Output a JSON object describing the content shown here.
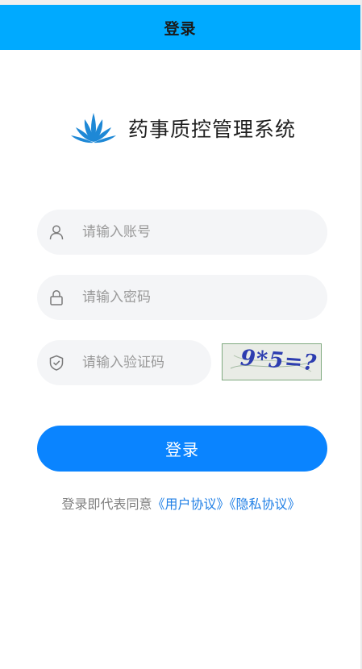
{
  "header": {
    "title": "登录"
  },
  "brand": {
    "app_name": "药事质控管理系统",
    "logo_icon": "lotus-logo-icon",
    "logo_color": "#1e88d6"
  },
  "form": {
    "username": {
      "placeholder": "请输入账号",
      "value": "",
      "icon": "user-icon"
    },
    "password": {
      "placeholder": "请输入密码",
      "value": "",
      "icon": "lock-icon"
    },
    "captcha": {
      "placeholder": "请输入验证码",
      "value": "",
      "icon": "shield-check-icon",
      "image_text": "9*5=?"
    }
  },
  "login_button": {
    "label": "登录"
  },
  "agreement": {
    "prefix": "登录即代表同意",
    "user_agreement": "《用户协议》",
    "privacy_policy": "《隐私协议》"
  },
  "colors": {
    "header_bg": "#00aaff",
    "primary": "#0a84ff",
    "link": "#1f7fe6",
    "field_bg": "#f4f5f7"
  }
}
